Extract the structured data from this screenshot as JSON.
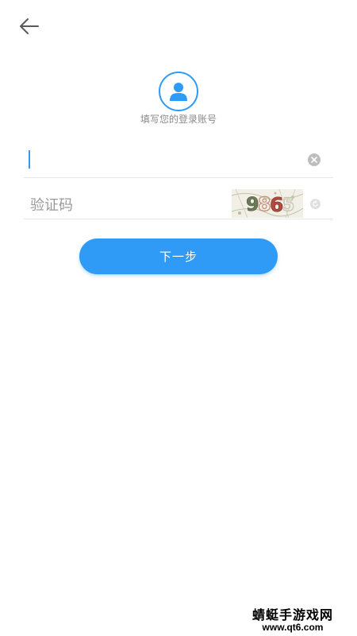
{
  "header": {
    "back_icon": "arrow-left-icon"
  },
  "profile": {
    "avatar_icon": "user-icon",
    "subtitle": "填写您的登录账号"
  },
  "form": {
    "account_value": "",
    "account_placeholder": "",
    "clear_icon": "clear-x-icon",
    "captcha_placeholder": "验证码",
    "captcha_text": "9 6",
    "refresh_icon": "refresh-icon",
    "next_label": "下一步"
  },
  "watermark": {
    "name": "蜻蜓手游戏网",
    "url": "www.qt6.com"
  },
  "colors": {
    "accent": "#2f9bf7",
    "background": "#ffffff",
    "text_secondary": "#8a8a8a",
    "divider": "#e6e6e6"
  }
}
